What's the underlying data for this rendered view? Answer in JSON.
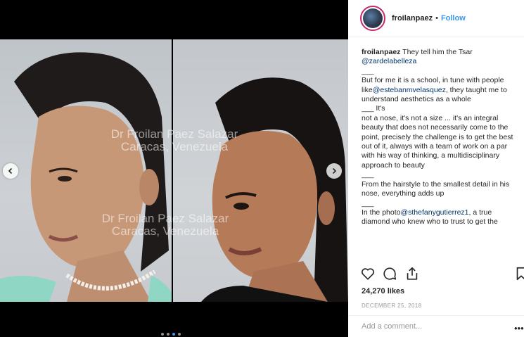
{
  "post": {
    "username": "froilanpaez",
    "separator": "•",
    "follow_label": "Follow",
    "likes": "24,270 likes",
    "date": "DECEMBER 25, 2018",
    "comment_placeholder": "Add a comment...",
    "more_label": "•••"
  },
  "media": {
    "watermark_top": [
      "Dr Froilan Paez Salazar",
      "Caracas, Venezuela"
    ],
    "watermark_bottom": [
      "Dr Froilan Paez Salazar",
      "Caracas, Venezuela"
    ],
    "carousel": {
      "count": 4,
      "active_index": 2
    }
  },
  "caption": {
    "user": "froilanpaez",
    "line1": " They tell him the Tsar",
    "mention1": "@zardelabelleza",
    "sep1": "___",
    "para2_before": "But for me it is a school, in tune with people like",
    "mention2": "@estebanmvelasquez",
    "para2_after": ", they taught me to understand aesthetics as a whole",
    "sep2": "___ It's",
    "para3": "not a nose, it's not a size ... it's an integral beauty that does not necessarily come to the point, precisely the challenge is to get the best out of it, always with a team of work on a par with his way of thinking, a multidisciplinary approach to beauty",
    "sep3": "___",
    "para4": "From the hairstyle to the smallest detail in his nose, everything adds up",
    "sep4": "___",
    "para5_before": "In the photo",
    "mention3": "@sthefanygutierrez1",
    "para5_after": ", a true diamond who knew who to trust to get the"
  },
  "colors": {
    "link": "#3897f0",
    "mention": "#003569",
    "avatar_ring": "#c72a6b"
  },
  "icons": [
    "heart-icon",
    "comment-icon",
    "share-icon",
    "bookmark-icon",
    "chevron-left-icon",
    "chevron-right-icon"
  ]
}
